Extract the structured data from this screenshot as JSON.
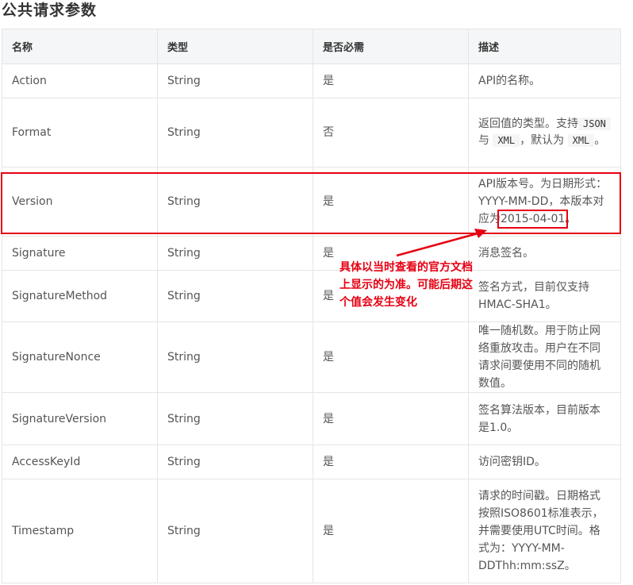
{
  "page": {
    "title": "公共请求参数"
  },
  "headers": [
    "名称",
    "类型",
    "是否必需",
    "描述"
  ],
  "rows": [
    {
      "name": "Action",
      "type": "String",
      "required": "是",
      "desc": "API的名称。"
    },
    {
      "name": "Format",
      "type": "String",
      "required": "否",
      "desc_parts": [
        "返回值的类型。支持",
        "JSON",
        "与",
        "XML",
        "，默认为",
        "XML",
        "。"
      ]
    },
    {
      "name": "Version",
      "type": "String",
      "required": "是",
      "desc_prefix": "API版本号。为日期形式：YYYY-MM-DD，本版本对应为",
      "desc_value": "2015-04-01",
      "desc_suffix": "。"
    },
    {
      "name": "Signature",
      "type": "String",
      "required": "是",
      "desc": "消息签名。"
    },
    {
      "name": "SignatureMethod",
      "type": "String",
      "required": "是",
      "desc": "签名方式，目前仅支持HMAC-SHA1。"
    },
    {
      "name": "SignatureNonce",
      "type": "String",
      "required": "是",
      "desc": "唯一随机数。用于防止网络重放攻击。用户在不同请求间要使用不同的随机数值。"
    },
    {
      "name": "SignatureVersion",
      "type": "String",
      "required": "是",
      "desc": "签名算法版本，目前版本是1.0。"
    },
    {
      "name": "AccessKeyId",
      "type": "String",
      "required": "是",
      "desc": "访问密钥ID。"
    },
    {
      "name": "Timestamp",
      "type": "String",
      "required": "是",
      "desc": "请求的时间戳。日期格式按照ISO8601标准表示，并需要使用UTC时间。格式为：YYYY-MM-DDThh:mm:ssZ。"
    }
  ],
  "annotation": {
    "note": "具体以当时查看的官方文档上显示的为准。可能后期这个值会发生变化",
    "color": "#e60012"
  }
}
